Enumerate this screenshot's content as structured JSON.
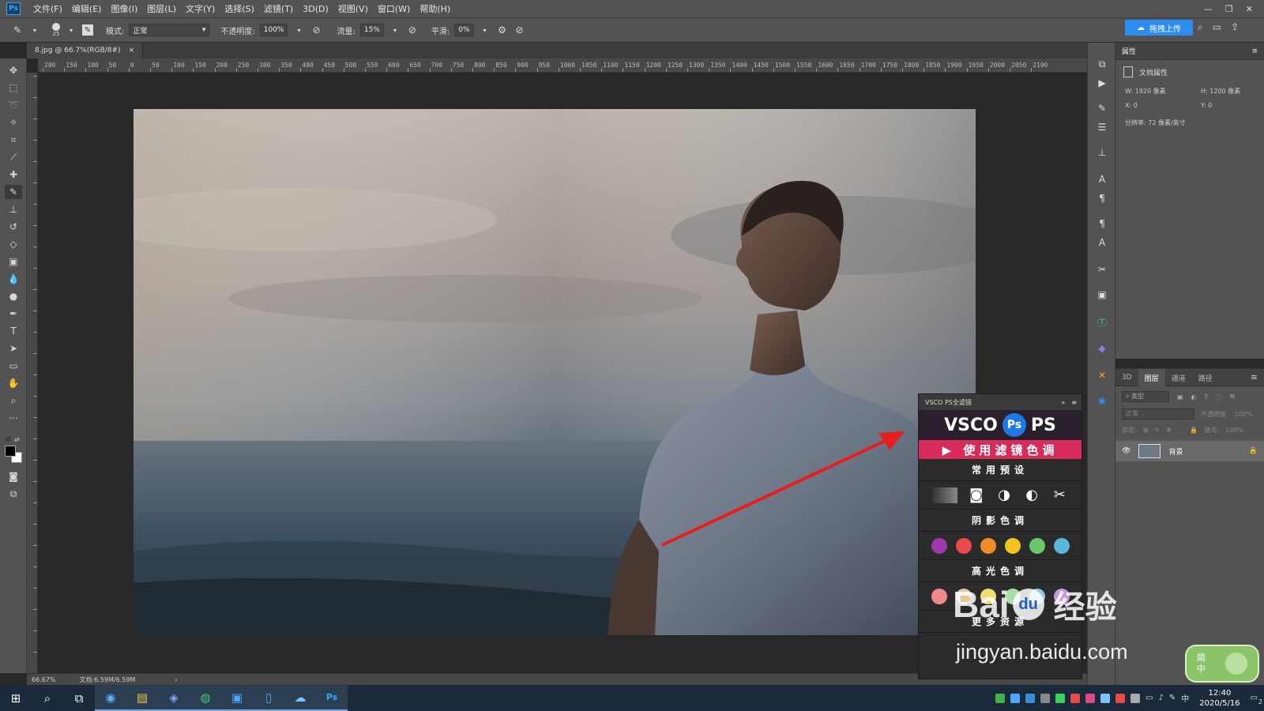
{
  "menubar": {
    "logo": "Ps",
    "items": [
      "文件(F)",
      "编辑(E)",
      "图像(I)",
      "图层(L)",
      "文字(Y)",
      "选择(S)",
      "滤镜(T)",
      "3D(D)",
      "视图(V)",
      "窗口(W)",
      "帮助(H)"
    ]
  },
  "options": {
    "brush_size": "25",
    "mode_label": "模式:",
    "mode_value": "正常",
    "opacity_label": "不透明度:",
    "opacity_value": "100%",
    "flow_label": "流量:",
    "flow_value": "15%",
    "smooth_label": "平滑:",
    "smooth_value": "0%",
    "upload_label": "拖拽上传"
  },
  "document": {
    "tab_title": "8.jpg @ 66.7%(RGB/8#)",
    "tab_close": "×",
    "zoom": "66.67%",
    "doc_info": "文档:6.59M/6.59M"
  },
  "ruler_top_labels": [
    "200",
    "150",
    "100",
    "50",
    "0",
    "50",
    "100",
    "150",
    "200",
    "250",
    "300",
    "350",
    "400",
    "450",
    "500",
    "550",
    "600",
    "650",
    "700",
    "750",
    "800",
    "850",
    "900",
    "950",
    "1000",
    "1050",
    "1100",
    "1150",
    "1200",
    "1250",
    "1300",
    "1350",
    "1400",
    "1450",
    "1500",
    "1550",
    "1600",
    "1650",
    "1700",
    "1750",
    "1800",
    "1850",
    "1900",
    "1950",
    "2000",
    "2050",
    "2100"
  ],
  "properties": {
    "tab": "属性",
    "section": "文档属性",
    "w_label": "W:",
    "w_value": "1920 像素",
    "h_label": "H:",
    "h_value": "1200 像素",
    "x_label": "X:",
    "x_value": "0",
    "y_label": "Y:",
    "y_value": "0",
    "resolution": "分辨率: 72 像素/英寸"
  },
  "layers": {
    "tabs": [
      "3D",
      "图层",
      "通道",
      "路径"
    ],
    "active_tab": "图层",
    "filter_placeholder": "类型",
    "blend_mode": "正常",
    "opacity_label": "不透明度:",
    "opacity_value": "100%",
    "lock_label": "锁定:",
    "fill_label": "填充:",
    "fill_value": "100%",
    "layer_name": "背景"
  },
  "vsco": {
    "header": "VSCO PS全滤镜",
    "brand_left": "VSCO",
    "brand_logo": "Ps",
    "brand_right": "PS",
    "cta": "▶ 使用滤镜色调",
    "section_presets": "常用预设",
    "section_shadow": "阴影色调",
    "section_highlight": "高光色调",
    "section_more": "更多资源",
    "shadow_colors": [
      "#9b3aa8",
      "#ea4b4b",
      "#f08a2a",
      "#f2c421",
      "#6ac86a",
      "#5bb8d9"
    ],
    "highlight_colors": [
      "#f08a8a",
      "#e8c79a",
      "#f2dd7a",
      "#a6e0a6",
      "#8fcbe8",
      "#c59ad9"
    ]
  },
  "watermark": {
    "brand": "Bai",
    "brand2": "du",
    "suffix": "经验",
    "url": "jingyan.baidu.com"
  },
  "taskbar": {
    "ime_label": "中",
    "time": "12:40",
    "date": "2020/5/16",
    "notif_count": "2"
  },
  "ime_badge": {
    "top": "简",
    "bottom": "中"
  }
}
